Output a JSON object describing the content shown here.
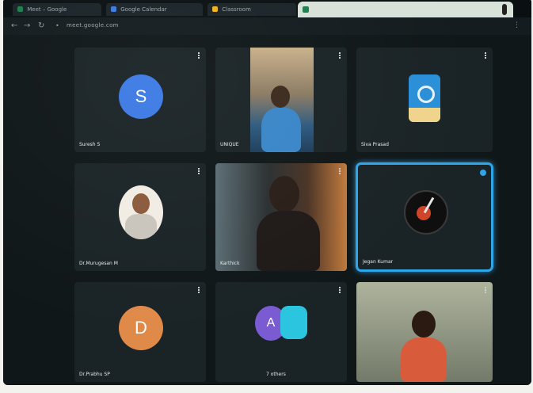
{
  "browser": {
    "tabs": [
      {
        "label": "Meet – Google",
        "favicon_color": "#1e7f4d"
      },
      {
        "label": "Google Calendar",
        "favicon_color": "#3b7ae0"
      },
      {
        "label": "Classroom",
        "favicon_color": "#f2b21b"
      }
    ],
    "active_tab_label": "",
    "url": "meet.google.com"
  },
  "participants": [
    {
      "name": "Suresh S",
      "type": "avatar",
      "initial": "S",
      "avatar_color": "#3c7ae3"
    },
    {
      "name": "UNIQUE",
      "type": "video"
    },
    {
      "name": "Siva Prasad",
      "type": "logo"
    },
    {
      "name": "Dr.Murugesan M",
      "type": "photo"
    },
    {
      "name": "Karthick",
      "type": "video"
    },
    {
      "name": "Jegan Kumar",
      "type": "logo",
      "speaking": true
    },
    {
      "name": "Dr.Prabhu SP",
      "type": "avatar",
      "initial": "D",
      "avatar_color": "#e08a4a"
    },
    {
      "name": "7 others",
      "type": "group",
      "initials": [
        "A",
        ""
      ],
      "colors": [
        "#7a5bd1",
        "#2cc5e0"
      ]
    },
    {
      "name": "",
      "type": "video"
    }
  ],
  "colors": {
    "speaking_border": "#2fa4e7",
    "tile_bg": "#1a2326",
    "stage_bg": "#101719"
  }
}
